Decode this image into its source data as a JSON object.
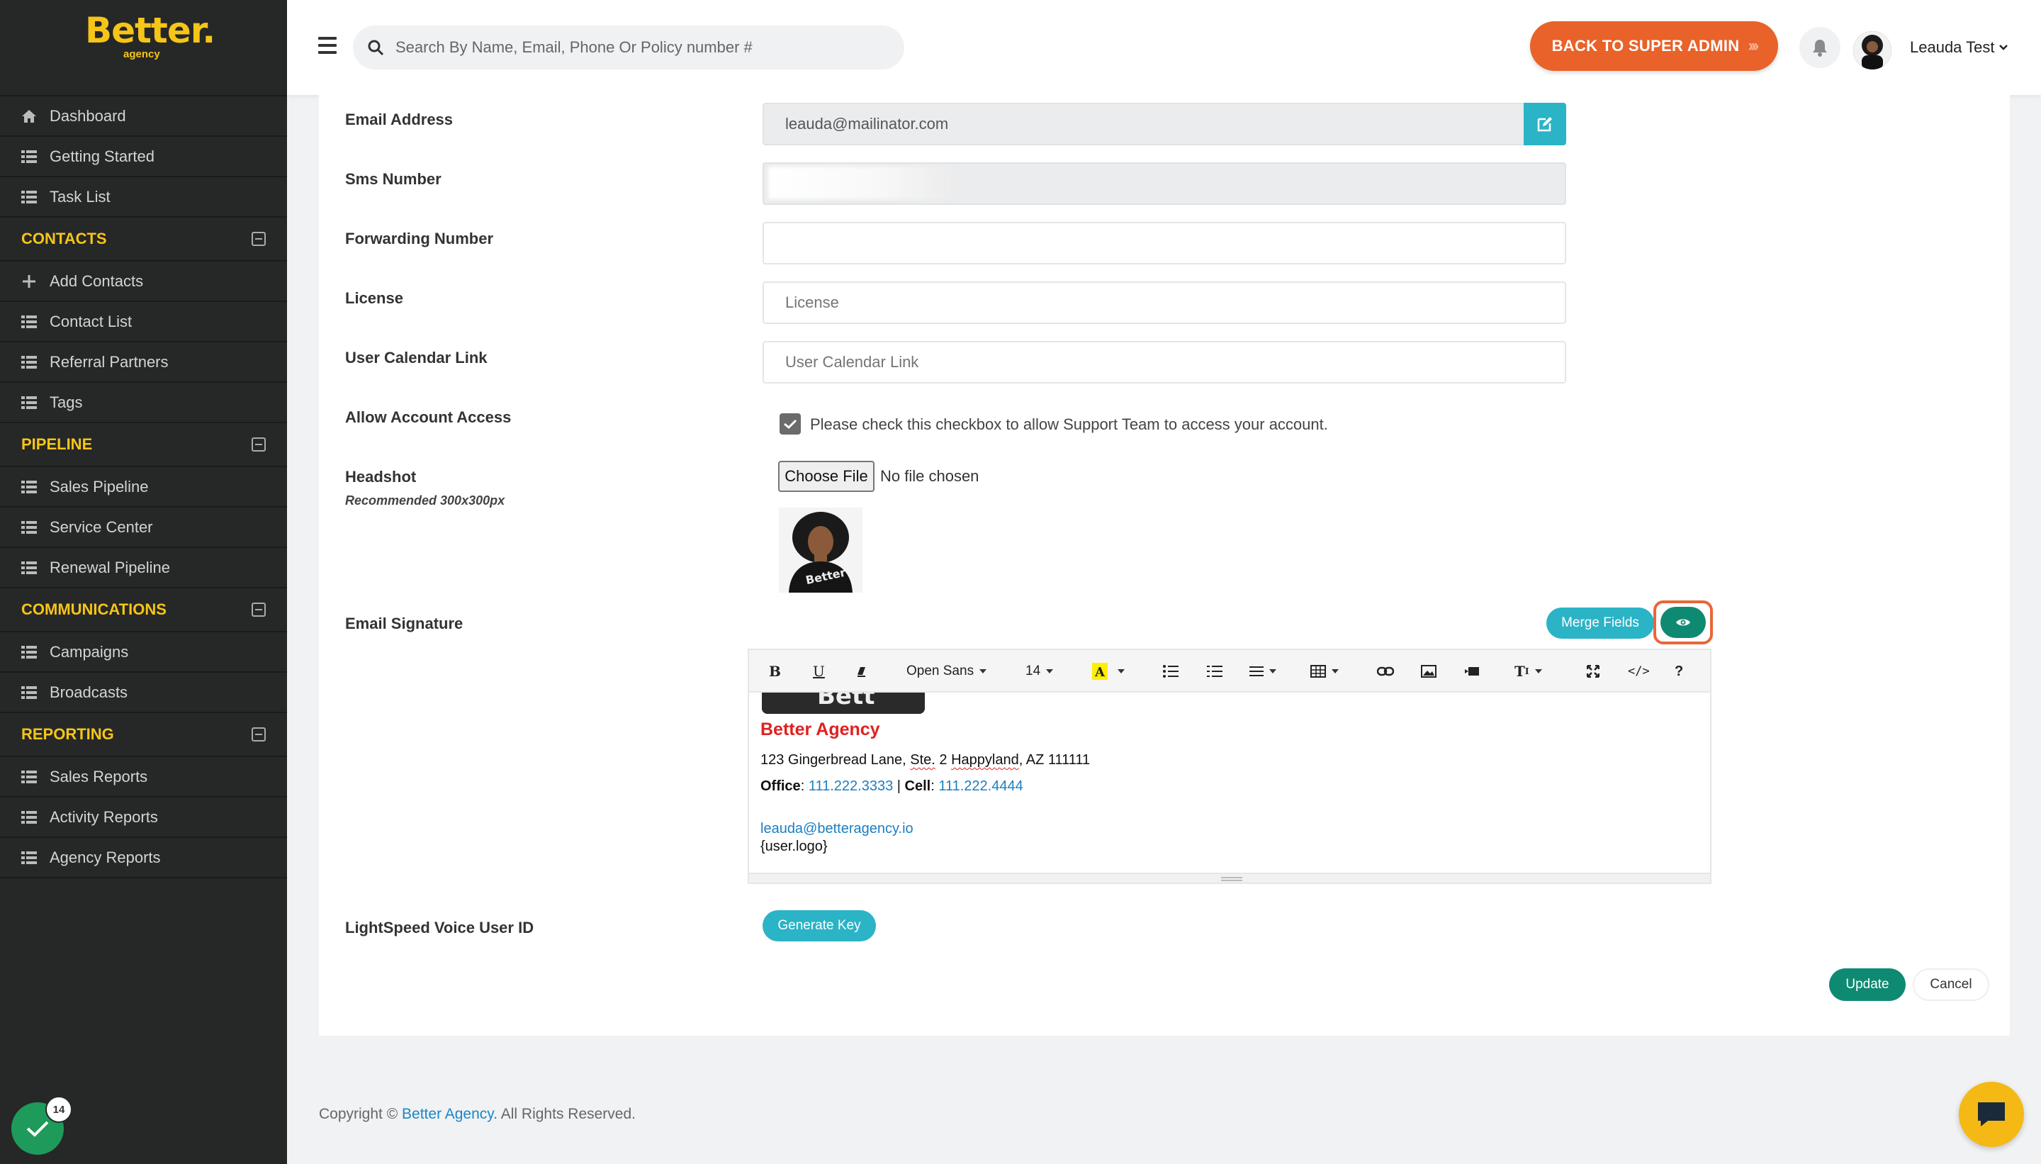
{
  "brand": {
    "logo_main": "Better.",
    "logo_sub": "agency"
  },
  "sidebar": {
    "top_items": [
      {
        "label": "Dashboard",
        "icon": "home-icon"
      },
      {
        "label": "Getting Started",
        "icon": "list-icon"
      },
      {
        "label": "Task List",
        "icon": "list-icon"
      }
    ],
    "sections": [
      {
        "title": "CONTACTS",
        "items": [
          "Add Contacts",
          "Contact List",
          "Referral Partners",
          "Tags"
        ]
      },
      {
        "title": "PIPELINE",
        "items": [
          "Sales Pipeline",
          "Service Center",
          "Renewal Pipeline"
        ]
      },
      {
        "title": "COMMUNICATIONS",
        "items": [
          "Campaigns",
          "Broadcasts"
        ]
      },
      {
        "title": "REPORTING",
        "items": [
          "Sales Reports",
          "Activity Reports",
          "Agency Reports"
        ]
      }
    ],
    "notification_count": "14"
  },
  "topbar": {
    "search_placeholder": "Search By Name, Email, Phone Or Policy number #",
    "super_admin_label": "BACK TO SUPER ADMIN",
    "user_name": "Leauda Test"
  },
  "form": {
    "email": {
      "label": "Email Address",
      "value": "leauda@mailinator.com"
    },
    "sms": {
      "label": "Sms Number",
      "value": ""
    },
    "forwarding": {
      "label": "Forwarding Number",
      "value": ""
    },
    "license": {
      "label": "License",
      "placeholder": "License"
    },
    "calendar": {
      "label": "User Calendar Link",
      "placeholder": "User Calendar Link"
    },
    "access": {
      "label": "Allow Account Access",
      "checkbox_text": "Please check this checkbox to allow Support Team to access your account.",
      "checked": true
    },
    "headshot": {
      "label": "Headshot",
      "sublabel": "Recommended 300x300px",
      "file_button": "Choose File",
      "file_status": "No file chosen"
    },
    "signature": {
      "label": "Email Signature",
      "merge_fields_label": "Merge Fields",
      "toolbar": {
        "font_family": "Open Sans",
        "font_size": "14"
      },
      "content": {
        "company": "Better Agency",
        "address_before": "123 Gingerbread Lane, ",
        "address_ste": "Ste.",
        "address_mid": " 2 ",
        "address_city": "Happyland",
        "address_after": ", AZ 111111",
        "office_label": "Office",
        "office_number": "111.222.3333",
        "cell_label": "Cell",
        "cell_number": "111.222.4444",
        "email": "leauda@betteragency.io",
        "logo_merge": "{user.logo}"
      }
    },
    "lightspeed": {
      "label": "LightSpeed Voice User ID",
      "button": "Generate Key"
    },
    "update_label": "Update",
    "cancel_label": "Cancel"
  },
  "footer": {
    "prefix": "Copyright © ",
    "brand": "Better Agency",
    "suffix": ". All Rights Reserved."
  },
  "colors": {
    "accent_yellow": "#f5c518",
    "admin_orange": "#e8622a",
    "teal": "#2bb3c6",
    "green": "#0f8a72",
    "sidebar_bg": "#262727"
  }
}
